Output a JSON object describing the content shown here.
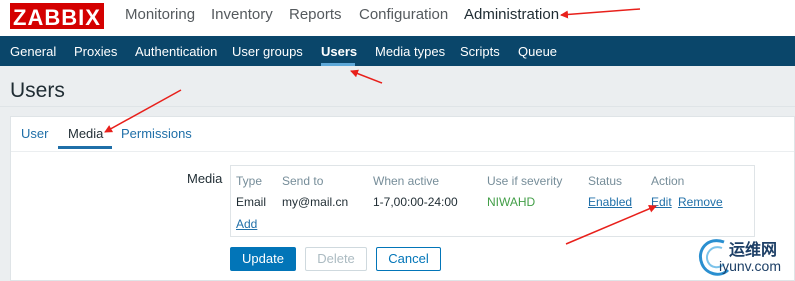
{
  "logo": "ZABBIX",
  "main_menu": {
    "monitoring": "Monitoring",
    "inventory": "Inventory",
    "reports": "Reports",
    "configuration": "Configuration",
    "administration": "Administration"
  },
  "sub_menu": {
    "general": "General",
    "proxies": "Proxies",
    "authentication": "Authentication",
    "user_groups": "User groups",
    "users": "Users",
    "media_types": "Media types",
    "scripts": "Scripts",
    "queue": "Queue"
  },
  "page_title": "Users",
  "tabs": {
    "user": "User",
    "media": "Media",
    "permissions": "Permissions"
  },
  "media_label": "Media",
  "media_table": {
    "headers": {
      "type": "Type",
      "send_to": "Send to",
      "when_active": "When active",
      "severity": "Use if severity",
      "status": "Status",
      "action": "Action"
    },
    "row": {
      "type": "Email",
      "send_to": "my@mail.cn",
      "when_active": "1-7,00:00-24:00",
      "severity": "NIWAHD",
      "status": "Enabled",
      "edit": "Edit",
      "remove": "Remove"
    },
    "add": "Add"
  },
  "buttons": {
    "update": "Update",
    "delete": "Delete",
    "cancel": "Cancel"
  },
  "watermark": {
    "cn": "运维网",
    "en": "iyunv.com"
  },
  "colors": {
    "logo_red": "#d40000",
    "nav_blue": "#0a466a",
    "link_blue": "#1f6fa8",
    "enabled_green": "#429e47",
    "arrow_red": "#e8201b"
  }
}
